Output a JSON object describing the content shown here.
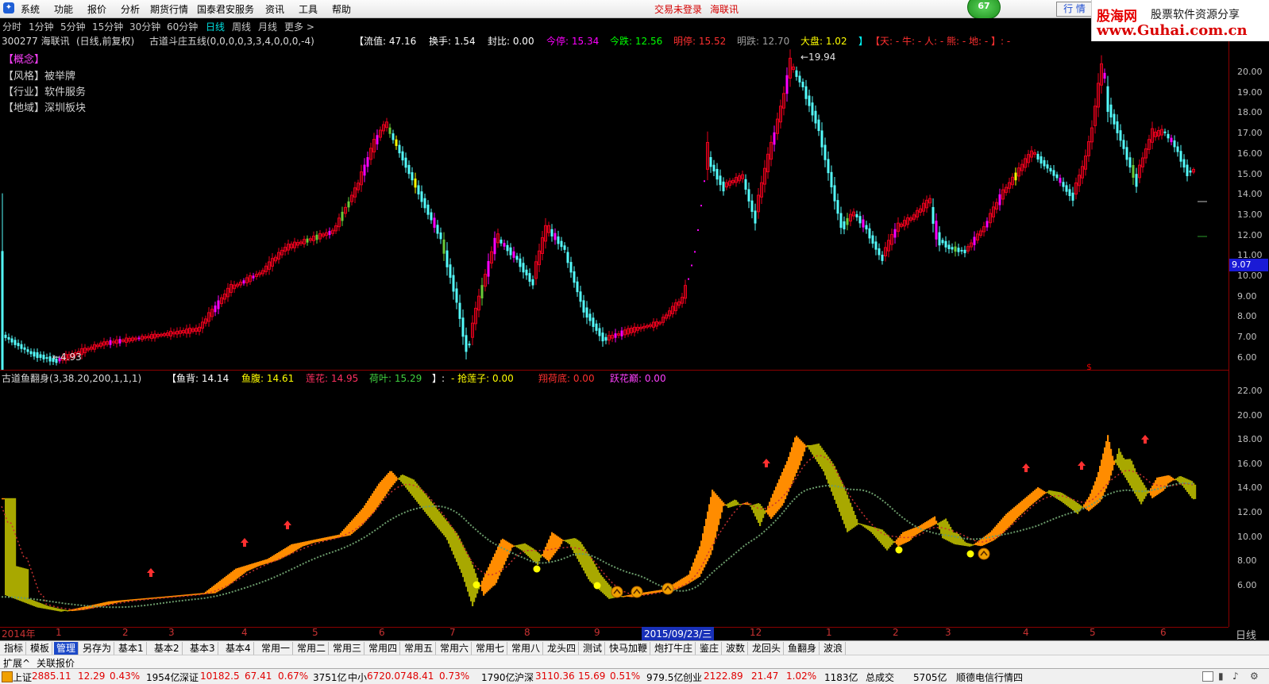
{
  "menubar": {
    "items": [
      "系统",
      "功能",
      "报价",
      "分析",
      "期货行情",
      "国泰君安服务",
      "资讯",
      "工具",
      "帮助"
    ],
    "login_status": "交易未登录",
    "stock_name_title": "海联讯",
    "badge": "67",
    "tab_label": "行 情"
  },
  "brand": {
    "name": "股海网",
    "slogan": "股票软件资源分享",
    "url": "www.Guhai.com.cn"
  },
  "periods": {
    "items": [
      "分时",
      "1分钟",
      "5分钟",
      "15分钟",
      "30分钟",
      "60分钟",
      "日线",
      "周线",
      "月线",
      "更多 >"
    ],
    "active": "日线"
  },
  "main_info": {
    "code_name": "300277 海联讯",
    "mode": "(日线,前复权)",
    "indicator": "古道斗庄五线(0,0,0,0,3,3,4,0,0,0,-4)",
    "liuzhi": "【流值: 47.16",
    "huanshou": "换手: 1.54",
    "fengbi": "封比: 0.00",
    "jinting": "今停: 15.34",
    "jindie": "今跌: 12.56",
    "mingting": "明停: 15.52",
    "mingdie": "明跌: 12.70",
    "dapan": "大盘: 1.02",
    "bracket": "】",
    "tianren": "【天: - 牛: - 人: - 熊: - 地: - 】: -"
  },
  "concepts": {
    "title": "【概念】",
    "style": "【风格】被举牌",
    "industry": "【行业】软件服务",
    "region": "【地域】深圳板块"
  },
  "price_marks": {
    "high": "19.94",
    "low": "4.93",
    "current": "9.07"
  },
  "y_axis_main": [
    "20.00",
    "19.00",
    "18.00",
    "17.00",
    "16.00",
    "15.00",
    "14.00",
    "13.00",
    "12.00",
    "11.00",
    "10.00",
    "9.00",
    "8.00",
    "7.00",
    "6.00"
  ],
  "sub_info": {
    "indicator": "古道鱼翻身(3,38.20,200,1,1,1)",
    "yubei": "【鱼背: 14.14",
    "yufu": "鱼腹: 14.61",
    "lianhua": "莲花: 14.95",
    "heye": "荷叶: 15.29",
    "sep": "】:",
    "qianglianzi": "- 抢莲子: 0.00",
    "xianghedi": "翔荷底: 0.00",
    "yuehuadian": "跃花巅: 0.00"
  },
  "y_axis_sub": [
    "22.00",
    "20.00",
    "18.00",
    "16.00",
    "14.00",
    "12.00",
    "10.00",
    "8.00",
    "6.00"
  ],
  "date_axis": {
    "year": "2014年",
    "months": [
      "1",
      "2",
      "3",
      "4",
      "5",
      "6",
      "7",
      "8",
      "9",
      "12",
      "1",
      "2",
      "3",
      "4",
      "5",
      "6"
    ],
    "cursor": "2015/09/23/三"
  },
  "period_label": "日线",
  "indicator_tabs": [
    "指标",
    "模板",
    "管理",
    "另存为",
    "基本1",
    "基本2",
    "基本3",
    "基本4",
    "常用一",
    "常用二",
    "常用三",
    "常用四",
    "常用五",
    "常用六",
    "常用七",
    "常用八",
    "龙头四",
    "测试",
    "快马加鞭",
    "炮打牛庄",
    "鉴庄",
    "波数",
    "龙回头",
    "鱼翻身",
    "波浪"
  ],
  "active_tab": "管理",
  "ext_bar": [
    "扩展^",
    "关联报价"
  ],
  "status_bar": {
    "sh": {
      "name": "上证",
      "val": "2885.11",
      "chg": "12.29",
      "pct": "0.43%",
      "amt": "1954亿"
    },
    "sz": {
      "name": "深证",
      "val": "10182.5",
      "chg": "67.41",
      "pct": "0.67%",
      "amt": "3751亿"
    },
    "zx": {
      "name": "中小",
      "val": "6720.07",
      "chg": "48.41",
      "pct": "0.73%",
      "amt": "1790亿"
    },
    "hs": {
      "name": "沪深",
      "val": "3110.36",
      "chg": "15.69",
      "pct": "0.51%",
      "amt": "979.5亿"
    },
    "cy": {
      "name": "创业",
      "val": "2122.89",
      "chg": "21.47",
      "pct": "1.02%",
      "amt": "1183亿"
    },
    "total_label": "总成交",
    "total": "5705亿",
    "provider": "顺德电信行情四"
  },
  "colors": {
    "up": "#e8001c",
    "down": "#54fcfc",
    "magenta": "#ff00ff",
    "orange": "#ff8c00",
    "olive": "#a8a800",
    "yellow": "#ffff00",
    "green": "#6acb3a"
  }
}
